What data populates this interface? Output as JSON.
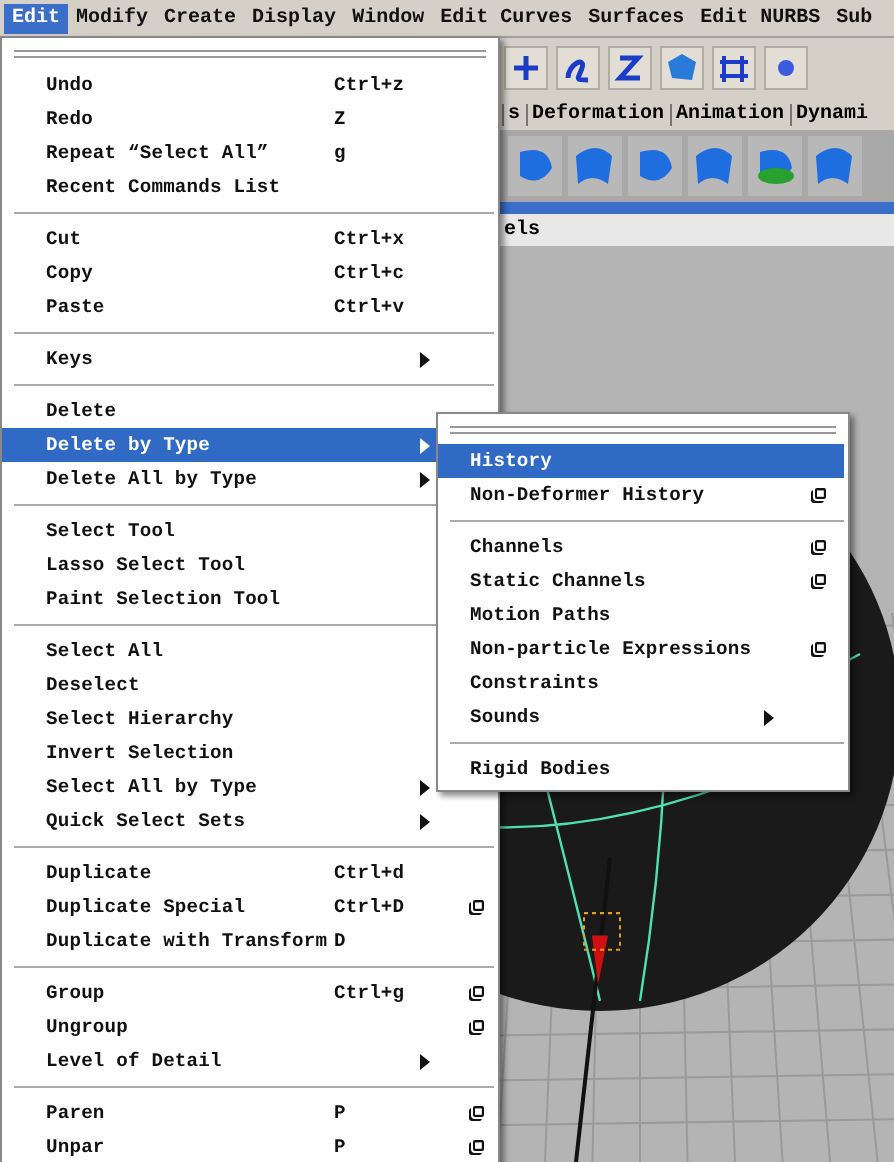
{
  "menubar": [
    {
      "label": "Edit",
      "selected": true
    },
    {
      "label": "Modify",
      "selected": false
    },
    {
      "label": "Create",
      "selected": false
    },
    {
      "label": "Display",
      "selected": false
    },
    {
      "label": "Window",
      "selected": false
    },
    {
      "label": "Edit Curves",
      "selected": false
    },
    {
      "label": "Surfaces",
      "selected": false
    },
    {
      "label": "Edit NURBS",
      "selected": false
    },
    {
      "label": "Sub",
      "selected": false
    }
  ],
  "shelf_tabs": [
    {
      "label": "s",
      "selected": false
    },
    {
      "label": "Deformation",
      "selected": false
    },
    {
      "label": "Animation",
      "selected": false
    },
    {
      "label": "Dynami",
      "selected": false
    }
  ],
  "panel_menu": "els",
  "edit_menu": [
    [
      {
        "label": "Undo",
        "shortcut": "Ctrl+z",
        "selected": false
      },
      {
        "label": "Redo",
        "shortcut": "Z",
        "selected": false
      },
      {
        "label": "Repeat “Select All”",
        "shortcut": "g",
        "selected": false
      },
      {
        "label": "Recent Commands List",
        "selected": false
      }
    ],
    [
      {
        "label": "Cut",
        "shortcut": "Ctrl+x",
        "selected": false
      },
      {
        "label": "Copy",
        "shortcut": "Ctrl+c",
        "selected": false
      },
      {
        "label": "Paste",
        "shortcut": "Ctrl+v",
        "selected": false
      }
    ],
    [
      {
        "label": "Keys",
        "submenu": true,
        "selected": false
      }
    ],
    [
      {
        "label": "Delete",
        "selected": false
      },
      {
        "label": "Delete by Type",
        "submenu": true,
        "selected": true
      },
      {
        "label": "Delete All by Type",
        "submenu": true,
        "selected": false
      }
    ],
    [
      {
        "label": "Select Tool",
        "selected": false
      },
      {
        "label": "Lasso Select Tool",
        "selected": false
      },
      {
        "label": "Paint Selection Tool",
        "selected": false
      }
    ],
    [
      {
        "label": "Select All",
        "selected": false
      },
      {
        "label": "Deselect",
        "selected": false
      },
      {
        "label": "Select Hierarchy",
        "selected": false
      },
      {
        "label": "Invert Selection",
        "selected": false
      },
      {
        "label": "Select All by Type",
        "submenu": true,
        "selected": false
      },
      {
        "label": "Quick Select Sets",
        "submenu": true,
        "selected": false
      }
    ],
    [
      {
        "label": "Duplicate",
        "shortcut": "Ctrl+d",
        "selected": false
      },
      {
        "label": "Duplicate Special",
        "shortcut": "Ctrl+D",
        "option_box": true,
        "selected": false
      },
      {
        "label": "Duplicate with Transform",
        "shortcut": "D",
        "selected": false
      }
    ],
    [
      {
        "label": "Group",
        "shortcut": "Ctrl+g",
        "option_box": true,
        "selected": false
      },
      {
        "label": "Ungroup",
        "option_box": true,
        "selected": false
      },
      {
        "label": "Level of Detail",
        "submenu": true,
        "selected": false
      }
    ],
    [
      {
        "label": "Paren",
        "shortcut": "P",
        "option_box": true,
        "selected": false
      },
      {
        "label": "Unpar",
        "shortcut": "P",
        "option_box": true,
        "selected": false
      }
    ]
  ],
  "delete_by_type_menu": [
    [
      {
        "label": "History",
        "selected": true
      },
      {
        "label": "Non-Deformer History",
        "option_box": true,
        "selected": false
      }
    ],
    [
      {
        "label": "Channels",
        "option_box": true,
        "selected": false
      },
      {
        "label": "Static Channels",
        "option_box": true,
        "selected": false
      },
      {
        "label": "Motion Paths",
        "selected": false
      },
      {
        "label": "Non-particle Expressions",
        "option_box": true,
        "selected": false
      },
      {
        "label": "Constraints",
        "selected": false
      },
      {
        "label": "Sounds",
        "submenu": true,
        "selected": false
      }
    ],
    [
      {
        "label": "Rigid Bodies",
        "selected": false
      }
    ]
  ]
}
